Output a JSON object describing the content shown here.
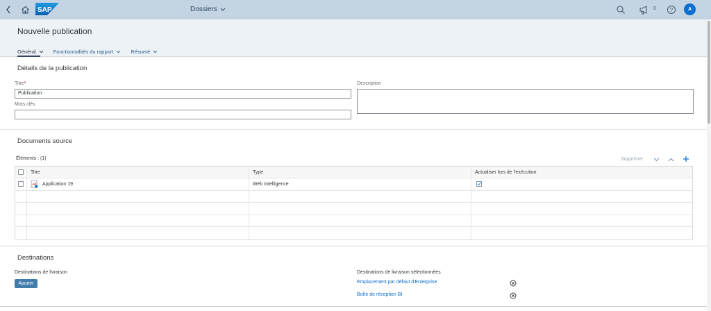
{
  "shell": {
    "title": "Dossiers",
    "notification_count": "0",
    "avatar_initial": "A",
    "logo_text": "SAP",
    "colors": {
      "shellbar": "#c4d4e2",
      "accent": "#0a6ed1"
    }
  },
  "header": {
    "title": "Nouvelle publication",
    "tabs": [
      {
        "label": "Général",
        "icon": "chevron-down-icon",
        "active": true
      },
      {
        "label": "Fonctionnalités du rapport",
        "icon": "chevron-down-icon",
        "active": false
      },
      {
        "label": "Résumé",
        "icon": "chevron-down-icon",
        "active": false
      }
    ]
  },
  "details": {
    "section_title": "Détails de la publication",
    "title_label": "Titre",
    "required_marker": "*",
    "title_value": "Publication",
    "keywords_label": "Mots clés",
    "keywords_value": "",
    "description_label": "Description",
    "description_value": ""
  },
  "sources": {
    "section_title": "Documents source",
    "count_label": "Éléments : (1)",
    "delete_label": "Supprimer",
    "columns": [
      "Titre",
      "Type",
      "Actualiser lors de l'exécution"
    ],
    "rows": [
      {
        "title": "Application 19",
        "type": "Web Intelligence",
        "refresh": true,
        "icon": "webi-document-icon"
      }
    ]
  },
  "destinations": {
    "section_title": "Destinations",
    "delivery_label": "Destinations de livraison",
    "add_label": "Ajouter",
    "selected_label": "Destinations de livraison sélectionnées",
    "selected": [
      "Emplacement par défaut d'Enterprise",
      "Boîte de réception BI"
    ]
  }
}
